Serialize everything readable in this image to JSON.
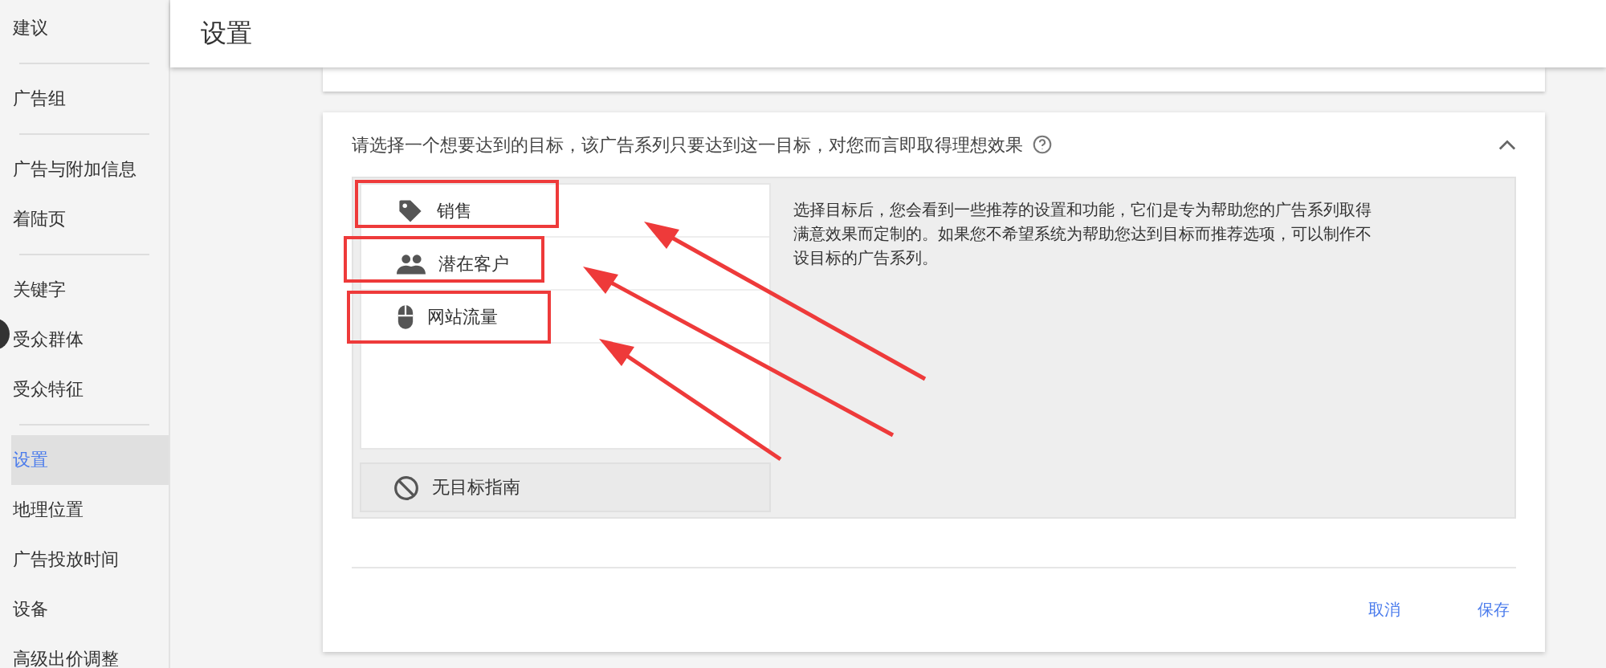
{
  "sidebar": {
    "groups": [
      {
        "items": [
          {
            "label": "建议",
            "selected": false
          }
        ]
      },
      {
        "items": [
          {
            "label": "广告组",
            "selected": false
          }
        ]
      },
      {
        "items": [
          {
            "label": "广告与附加信息",
            "selected": false
          },
          {
            "label": "着陆页",
            "selected": false
          }
        ]
      },
      {
        "items": [
          {
            "label": "关键字",
            "selected": false
          },
          {
            "label": "受众群体",
            "selected": false
          },
          {
            "label": "受众特征",
            "selected": false
          }
        ]
      },
      {
        "items": [
          {
            "label": "设置",
            "selected": true
          },
          {
            "label": "地理位置",
            "selected": false
          },
          {
            "label": "广告投放时间",
            "selected": false
          },
          {
            "label": "设备",
            "selected": false
          },
          {
            "label": "高级出价调整",
            "selected": false
          }
        ]
      }
    ]
  },
  "header": {
    "title": "设置"
  },
  "goal_card": {
    "question": "请选择一个想要达到的目标，该广告系列只要达到这一目标，对您而言即取得理想效果",
    "expanded": true,
    "goals": [
      {
        "kind": "tag",
        "label": "销售",
        "highlighted": true
      },
      {
        "kind": "people",
        "label": "潜在客户",
        "highlighted": true
      },
      {
        "kind": "mouse",
        "label": "网站流量",
        "highlighted": true
      }
    ],
    "no_goal": "无目标指南",
    "description": "选择目标后，您会看到一些推荐的设置和功能，它们是专为帮助您的广告系列取得满意效果而定制的。如果您不希望系统为帮助您达到目标而推荐选项，可以制作不设目标的广告系列。",
    "buttons": [
      "取消",
      "保存"
    ]
  }
}
